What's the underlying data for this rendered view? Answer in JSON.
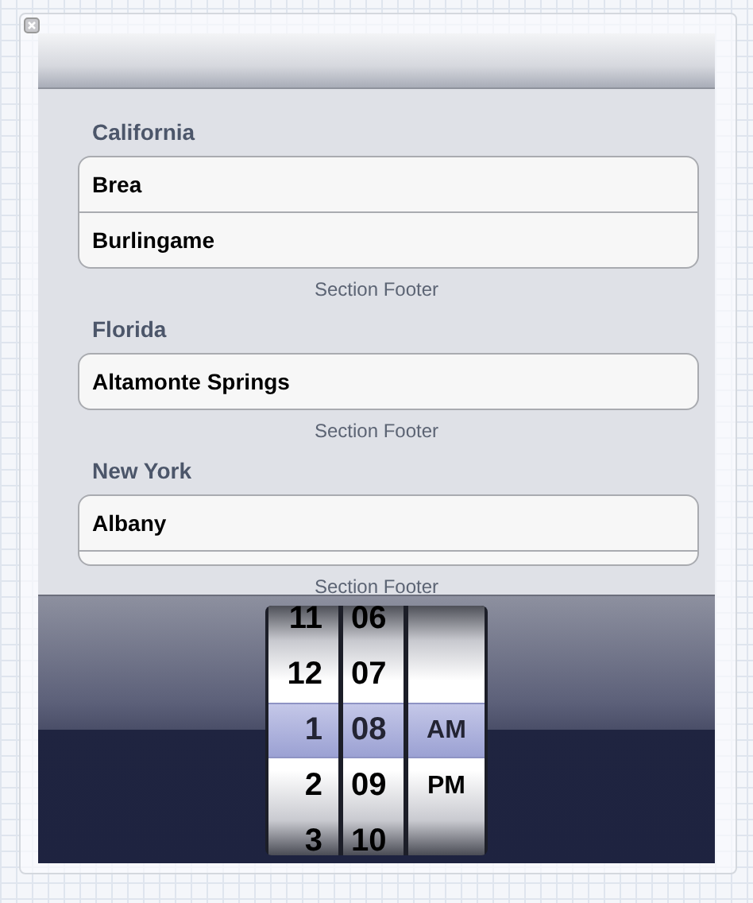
{
  "sections": [
    {
      "header": "California",
      "cells": [
        {
          "kind": "text",
          "label": "Brea"
        },
        {
          "kind": "text",
          "label": "Burlingame"
        }
      ],
      "footer": "Section Footer"
    },
    {
      "header": "Florida",
      "cells": [
        {
          "kind": "text",
          "label": "Altamonte Springs"
        }
      ],
      "footer": "Section Footer"
    },
    {
      "header": "New York",
      "cells": [
        {
          "kind": "text",
          "label": "Albany"
        },
        {
          "kind": "blank"
        }
      ],
      "footer": "Section Footer"
    }
  ],
  "picker": {
    "columns": [
      {
        "kind": "hour",
        "items": [
          {
            "label": "11",
            "selected": false
          },
          {
            "label": "12",
            "selected": false
          },
          {
            "label": "1",
            "selected": true
          },
          {
            "label": "2",
            "selected": false
          },
          {
            "label": "3",
            "selected": false
          }
        ]
      },
      {
        "kind": "minute",
        "items": [
          {
            "label": "06",
            "selected": false
          },
          {
            "label": "07",
            "selected": false
          },
          {
            "label": "08",
            "selected": true
          },
          {
            "label": "09",
            "selected": false
          },
          {
            "label": "10",
            "selected": false
          }
        ]
      },
      {
        "kind": "period",
        "items": [
          {
            "selected": false
          },
          {
            "selected": false
          },
          {
            "label": "AM",
            "selected": true
          },
          {
            "label": "PM",
            "selected": false
          },
          {
            "selected": false
          }
        ]
      }
    ]
  }
}
